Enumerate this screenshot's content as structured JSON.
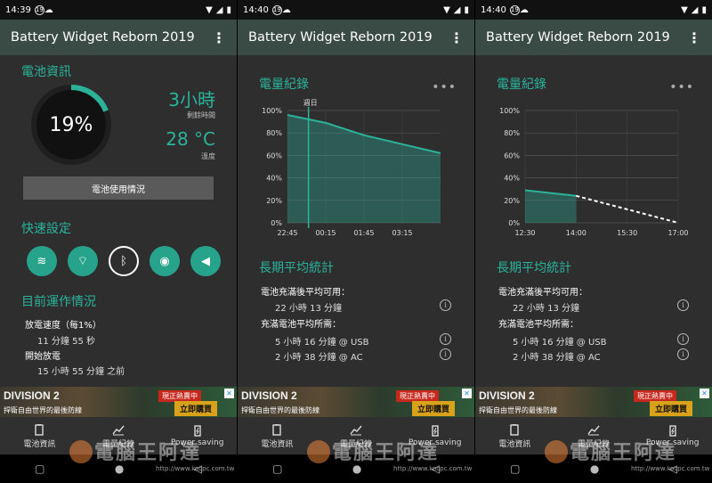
{
  "app_title": "Battery Widget Reborn 2019",
  "accent": "#2bb39a",
  "screens": [
    {
      "status_time": "14:39",
      "battery_info_title": "電池資訊",
      "battery_percent": "19%",
      "battery_level": 0.19,
      "remaining_value": "3小時",
      "remaining_label": "剩餘時間",
      "temp_value": "28 °C",
      "temp_label": "溫度",
      "usage_button": "電池使用情況",
      "quick_title": "快速設定",
      "quick_items": [
        "wifi-icon",
        "hotspot-icon",
        "bluetooth-icon",
        "auto-brightness-icon",
        "volume-icon"
      ],
      "status_title": "目前運作情況",
      "discharge_rate_label": "放電速度（每1%）",
      "discharge_rate_value": "11 分鐘 55 秒",
      "discharge_start_label": "開始放電",
      "discharge_start_value": "15 小時 55 分鐘 之前"
    },
    {
      "status_time": "14:40",
      "chart_title": "電量紀錄",
      "stats_title": "長期平均統計",
      "avg_after_full_label": "電池充滿後平均可用：",
      "avg_after_full_value": "22 小時 13 分鐘",
      "avg_charge_label": "充滿電池平均所需：",
      "avg_charge_usb": "5 小時 16 分鐘 @ USB",
      "avg_charge_ac": "2 小時 38 分鐘 @ AC"
    },
    {
      "status_time": "14:40",
      "chart_title": "電量紀錄",
      "stats_title": "長期平均統計",
      "avg_after_full_label": "電池充滿後平均可用：",
      "avg_after_full_value": "22 小時 13 分鐘",
      "avg_charge_label": "充滿電池平均所需：",
      "avg_charge_usb": "5 小時 16 分鐘 @ USB",
      "avg_charge_ac": "2 小時 38 分鐘 @ AC"
    }
  ],
  "chart_data": [
    {
      "type": "area",
      "title": "電量紀錄",
      "x": [
        "22:45",
        "00:15",
        "01:45",
        "03:15",
        "04:20"
      ],
      "x_ticks": [
        "22:45",
        "00:15",
        "01:45",
        "03:15"
      ],
      "y_ticks": [
        "100%",
        "80%",
        "60%",
        "40%",
        "20%",
        "0%"
      ],
      "series": [
        {
          "values": [
            96,
            89,
            78,
            70,
            62
          ]
        }
      ],
      "marker_label": "週日",
      "ylim": [
        0,
        100
      ],
      "grid": true
    },
    {
      "type": "area",
      "title": "電量紀錄",
      "x": [
        "12:30",
        "14:00",
        "15:30",
        "17:00"
      ],
      "x_ticks": [
        "12:30",
        "14:00",
        "15:30",
        "17:00"
      ],
      "y_ticks": [
        "100%",
        "80%",
        "60%",
        "40%",
        "20%",
        "0%"
      ],
      "series": [
        {
          "values": [
            29,
            24,
            null,
            null
          ]
        },
        {
          "values": [
            null,
            24,
            12,
            0
          ]
        }
      ],
      "ylim": [
        0,
        100
      ],
      "grid": true
    }
  ],
  "ad": {
    "brand": "DIVISION 2",
    "badge": "現正熱賣中",
    "cta": "立即購買",
    "tagline": "捍衛自由世界的最後防線"
  },
  "nav": {
    "items": [
      {
        "label": "電池資訊",
        "icon": "battery-info-icon"
      },
      {
        "label": "電量紀錄",
        "icon": "chart-icon"
      },
      {
        "label": "Power saving",
        "icon": "power-saving-icon"
      }
    ]
  },
  "watermark": {
    "text": "電腦王阿達",
    "url": "http://www.kocpc.com.tw"
  }
}
